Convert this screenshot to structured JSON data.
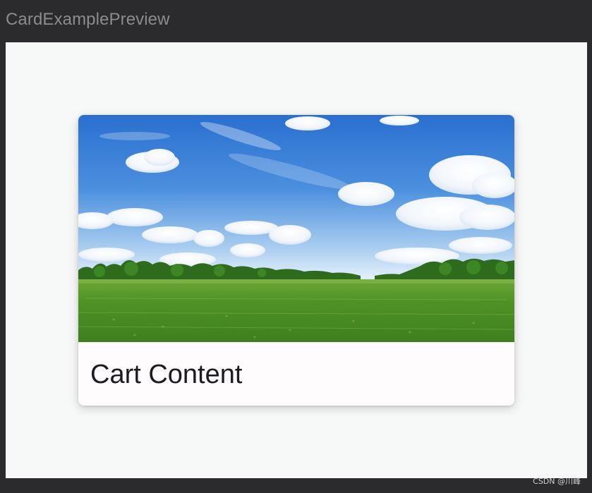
{
  "window": {
    "title": "CardExamplePreview"
  },
  "card": {
    "image_icon": "landscape-photo",
    "content_text": "Cart Content"
  },
  "watermark": {
    "text": "CSDN @川峰"
  },
  "colors": {
    "window_bg": "#2b2b2d",
    "preview_bg": "#f7f8f8",
    "card_bg": "#fffcfe",
    "title_text": "#8c8c8c",
    "card_text": "#1c1b1f"
  }
}
